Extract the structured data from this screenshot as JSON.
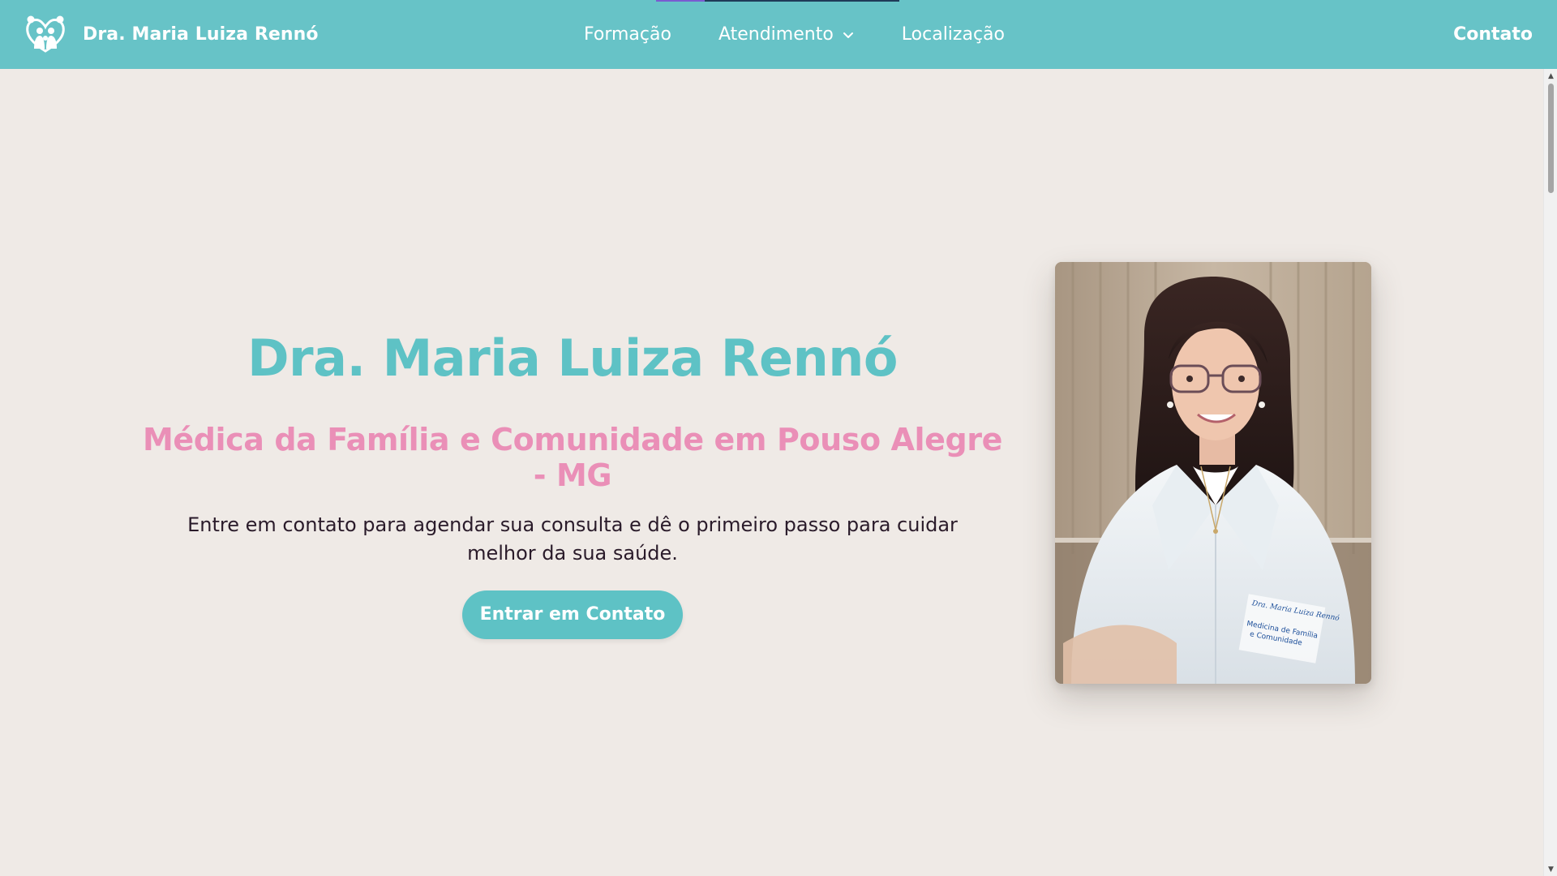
{
  "nav": {
    "brand_name": "Dra. Maria Luiza Rennó",
    "links": [
      {
        "label": "Formação"
      },
      {
        "label": "Atendimento"
      },
      {
        "label": "Localização"
      }
    ],
    "contact_label": "Contato"
  },
  "hero": {
    "title": "Dra. Maria Luiza Rennó",
    "subtitle": "Médica da Família e Comunidade em Pouso Alegre - MG",
    "body": "Entre em contato para agendar sua consulta e dê o primeiro passo para cuidar melhor da sua saúde.",
    "cta_label": "Entrar em Contato"
  },
  "photo": {
    "coat_text_line1": "Medicina de Família",
    "coat_text_line2": "e Comunidade",
    "coat_signature": "Dra. Maria Luiza Rennó"
  },
  "colors": {
    "brand_teal": "#67c3c7",
    "title_teal": "#5ec2c5",
    "accent_pink": "#ea8fb7",
    "background": "#efeae6"
  },
  "icons": {
    "logo": "family-heart-icon",
    "dropdown": "chevron-down-icon"
  }
}
